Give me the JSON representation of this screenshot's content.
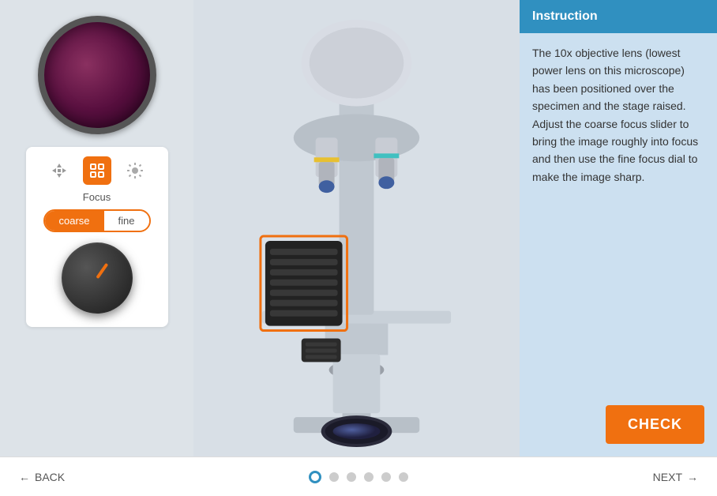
{
  "instruction": {
    "header": "Instruction",
    "body": "The 10x objective lens (lowest power lens on this microscope) has been positioned over the specimen and the stage raised. Adjust the coarse focus slider to bring the image roughly into focus and then use the fine focus dial to make the image sharp."
  },
  "controls": {
    "label": "Focus",
    "toggle_coarse": "coarse",
    "toggle_fine": "fine"
  },
  "buttons": {
    "check": "CHECK",
    "back": "BACK",
    "next": "NEXT"
  },
  "pagination": {
    "total": 6,
    "current": 0
  },
  "icons": {
    "arrows_up": "⇑",
    "target": "◎",
    "sun": "☀",
    "back_arrow": "←",
    "next_arrow": "→"
  }
}
